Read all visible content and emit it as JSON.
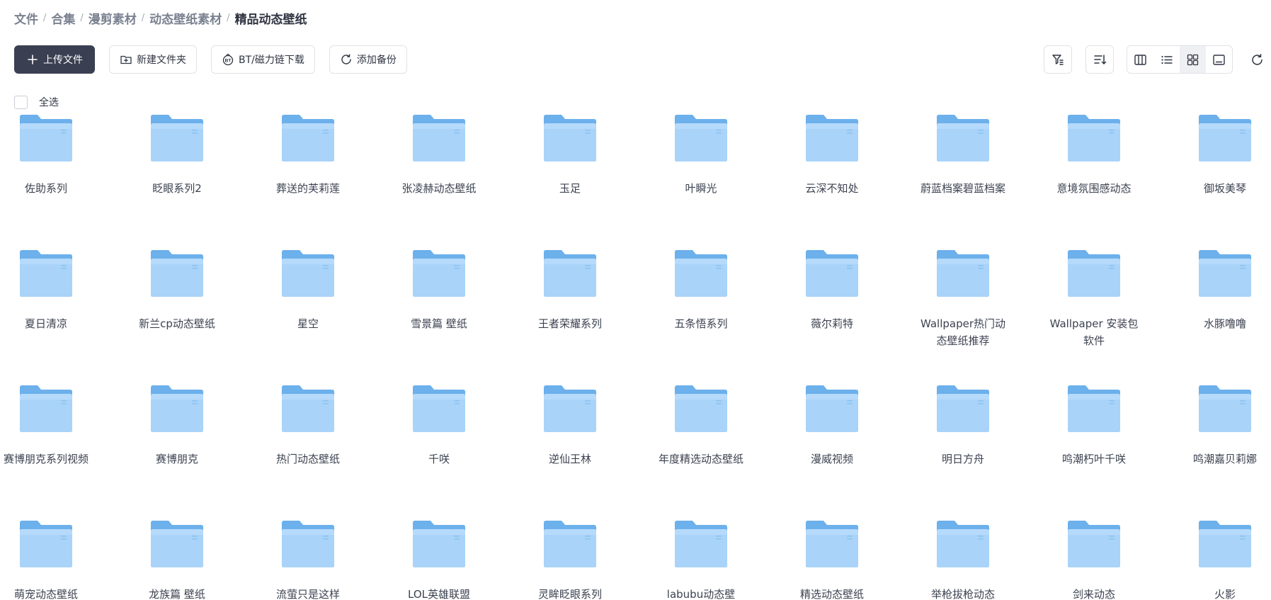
{
  "breadcrumb": [
    "文件",
    "合集",
    "漫剪素材",
    "动态壁纸素材",
    "精品动态壁纸"
  ],
  "toolbar": {
    "upload_label": "上传文件",
    "new_folder_label": "新建文件夹",
    "bt_label": "BT/磁力链下载",
    "backup_label": "添加备份"
  },
  "select_all_label": "全选",
  "view_mode": "grid",
  "colors": {
    "primary_button": "#3a3f51",
    "folder_body": "#a9d3f8",
    "folder_back": "#6cb0ec"
  },
  "folders": [
    "佐助系列",
    "眨眼系列2",
    "葬送的芙莉莲",
    "张凌赫动态壁纸",
    "玉足",
    "叶瞬光",
    "云深不知处",
    "蔚蓝档案碧蓝档案",
    "意境氛围感动态",
    "御坂美琴",
    "夏日清凉",
    "新兰cp动态壁纸",
    "星空",
    "雪景篇 壁纸",
    "王者荣耀系列",
    "五条悟系列",
    "薇尔莉特",
    "Wallpaper热门动态壁纸推荐",
    "Wallpaper 安装包软件",
    "水豚噜噜",
    "赛博朋克系列视频",
    "赛博朋克",
    "热门动态壁纸",
    "千咲",
    "逆仙王林",
    "年度精选动态壁纸",
    "漫威视频",
    "明日方舟",
    "鸣潮朽叶千咲",
    "鸣潮嘉贝莉娜",
    "萌宠动态壁纸",
    "龙族篇 壁纸",
    "流萤只是这样",
    "LOL英雄联盟",
    "灵眸眨眼系列",
    "labubu动态壁",
    "精选动态壁纸",
    "举枪拔枪动态",
    "剑来动态",
    "火影"
  ]
}
